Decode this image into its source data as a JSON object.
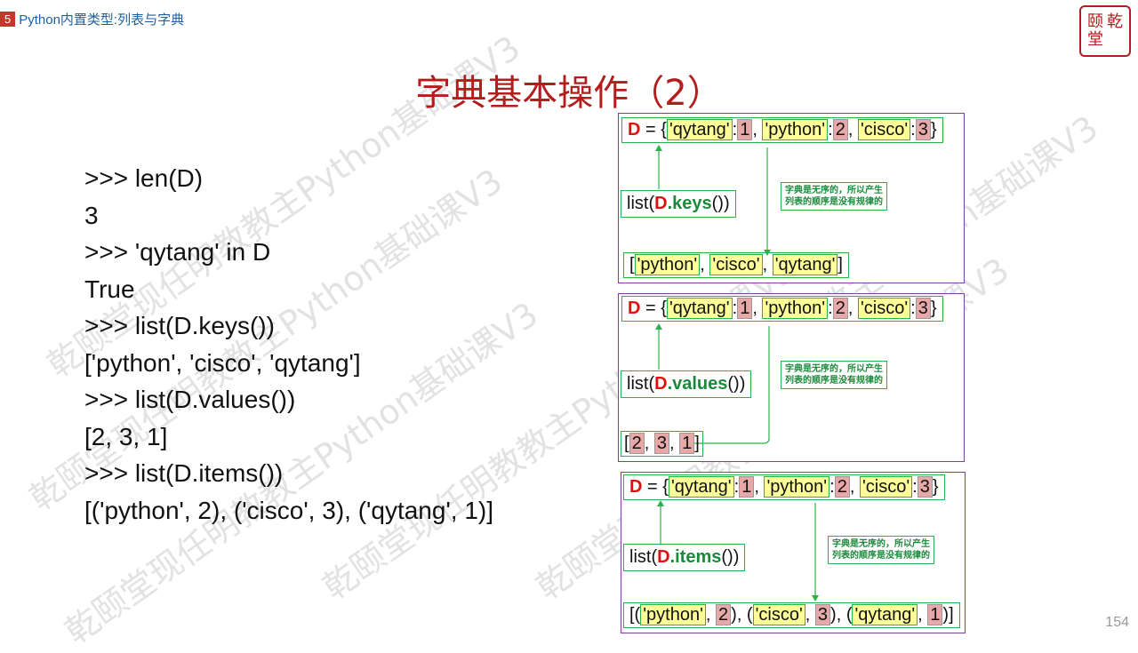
{
  "header": {
    "chapter_number": "5",
    "chapter_title": "Python内置类型:列表与字典"
  },
  "logo": {
    "chars": [
      "颐",
      "乾",
      "堂",
      ""
    ]
  },
  "title": "字典基本操作（2）",
  "console_lines": [
    ">>> len(D)",
    "3",
    ">>> 'qytang' in D",
    "True",
    ">>> list(D.keys())",
    "['python', 'cisco', 'qytang']",
    ">>> list(D.values())",
    "[2, 3, 1]",
    ">>> list(D.items())",
    "[('python', 2), ('cisco', 3), ('qytang', 1)]"
  ],
  "dict_literal": {
    "var": "D",
    "eq": " = {",
    "items": [
      {
        "key": "'qytang'",
        "value": "1"
      },
      {
        "key": "'python'",
        "value": "2"
      },
      {
        "key": "'cisco'",
        "value": "3"
      }
    ],
    "close": "}"
  },
  "panels": [
    {
      "call": {
        "prefix": "list(",
        "var": "D",
        "method": ".keys",
        "suffix": "())"
      },
      "note": [
        "字典是无序的，所以产生",
        "列表的顺序是没有规律的"
      ],
      "result_keys": [
        "'python'",
        "'cisco'",
        "'qytang'"
      ]
    },
    {
      "call": {
        "prefix": "list(",
        "var": "D",
        "method": ".values",
        "suffix": "())"
      },
      "note": [
        "字典是无序的，所以产生",
        "列表的顺序是没有规律的"
      ],
      "result_values": [
        "2",
        "3",
        "1"
      ]
    },
    {
      "call": {
        "prefix": "list(",
        "var": "D",
        "method": ".items",
        "suffix": "())"
      },
      "note": [
        "字典是无序的，所以产生",
        "列表的顺序是没有规律的"
      ],
      "result_items": [
        {
          "key": "'python'",
          "value": "2"
        },
        {
          "key": "'cisco'",
          "value": "3"
        },
        {
          "key": "'qytang'",
          "value": "1"
        }
      ]
    }
  ],
  "page_number": "154",
  "watermark": "乾颐堂现任明教教主Python基础课V3",
  "colors": {
    "title": "#b51c1c",
    "key_highlight": "#ffff99",
    "value_highlight": "#e8a8a8",
    "border_green": "#2bb04a",
    "panel_border": "#7b3f9e"
  }
}
